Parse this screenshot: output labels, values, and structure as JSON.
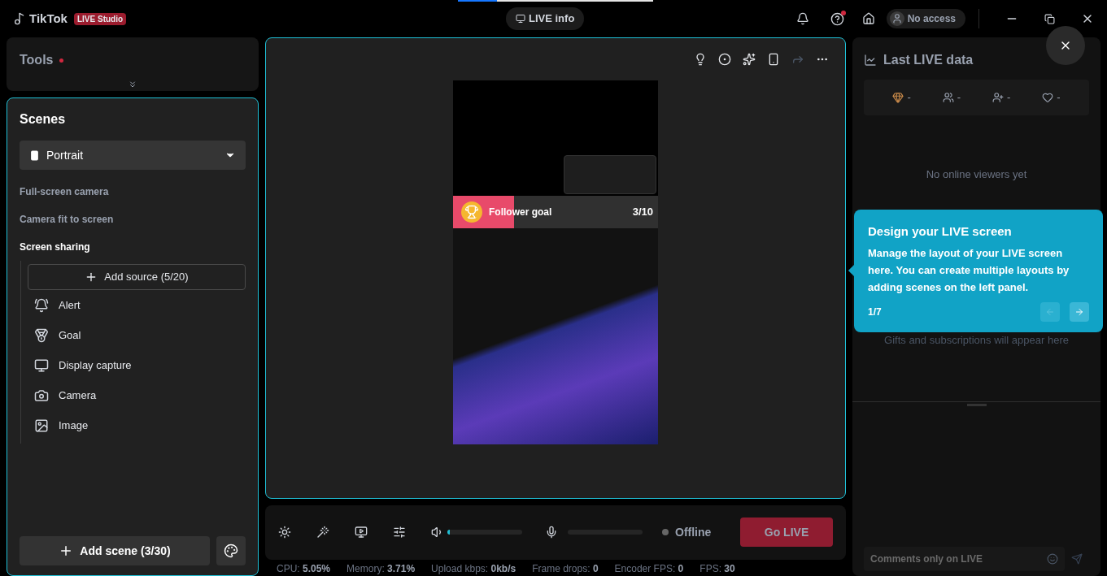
{
  "titlebar": {
    "app_name": "TikTok",
    "badge": "LIVE Studio",
    "live_info": "LIVE info",
    "account": "No access",
    "help_has_dot": true
  },
  "tools": {
    "title": "Tools",
    "has_dot": true
  },
  "scenes": {
    "title": "Scenes",
    "layout": "Portrait",
    "items": [
      {
        "label": "Full-screen camera",
        "selected": false
      },
      {
        "label": "Camera fit to screen",
        "selected": false
      },
      {
        "label": "Screen sharing",
        "selected": true
      }
    ],
    "add_source": "Add source (5/20)",
    "sources": [
      {
        "kind": "alert",
        "label": "Alert"
      },
      {
        "kind": "goal",
        "label": "Goal"
      },
      {
        "kind": "display",
        "label": "Display capture"
      },
      {
        "kind": "camera",
        "label": "Camera"
      },
      {
        "kind": "image",
        "label": "Image"
      }
    ],
    "add_scene": "Add scene (3/30)"
  },
  "preview": {
    "goal_label": "Follower goal",
    "goal_count": "3/10"
  },
  "controls": {
    "speaker": {
      "level": 0.03
    },
    "mic": {
      "level": 0
    },
    "status": "Offline",
    "go_live": "Go LIVE"
  },
  "stats": [
    {
      "label": "CPU:",
      "value": "5.05%"
    },
    {
      "label": "Memory:",
      "value": "3.71%"
    },
    {
      "label": "Upload kbps:",
      "value": "0kb/s"
    },
    {
      "label": "Frame drops:",
      "value": "0"
    },
    {
      "label": "Encoder FPS:",
      "value": "0"
    },
    {
      "label": "FPS:",
      "value": "30"
    }
  ],
  "last_live": {
    "title": "Last LIVE data",
    "metrics": [
      {
        "kind": "gifts",
        "value": "-"
      },
      {
        "kind": "viewers",
        "value": "-"
      },
      {
        "kind": "followers",
        "value": "-"
      },
      {
        "kind": "likes",
        "value": "-"
      }
    ],
    "empty_viewers": "No online viewers yet",
    "empty_gifts": "Gifts and subscriptions will appear here",
    "comment_placeholder": "Comments only on LIVE"
  },
  "tour": {
    "title": "Design your LIVE screen",
    "body": "Manage the layout of your LIVE screen here. You can create multiple layouts by adding scenes on the left panel.",
    "step": "1/7",
    "prev_disabled": true
  }
}
